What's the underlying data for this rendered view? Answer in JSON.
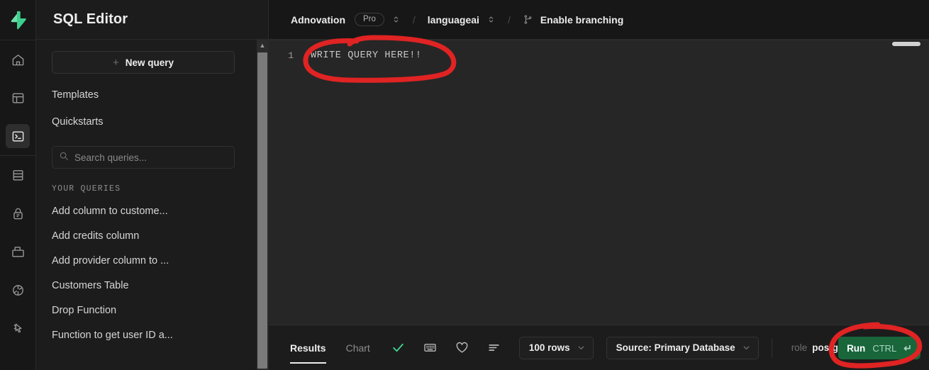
{
  "app": {
    "logo_icon": "supabase-lightning-logo",
    "sidebar_title": "SQL Editor"
  },
  "rail": {
    "items": [
      {
        "icon": "home-icon",
        "name": "home"
      },
      {
        "icon": "table-editor-icon",
        "name": "table-editor"
      },
      {
        "icon": "sql-editor-icon",
        "name": "sql-editor",
        "active": true
      },
      {
        "icon": "database-icon",
        "name": "database"
      },
      {
        "icon": "auth-lock-icon",
        "name": "authentication"
      },
      {
        "icon": "storage-folder-icon",
        "name": "storage"
      },
      {
        "icon": "edge-functions-icon",
        "name": "edge-functions"
      },
      {
        "icon": "advisors-cursor-icon",
        "name": "advisors"
      }
    ]
  },
  "sidebar": {
    "new_query_label": "New query",
    "new_query_icon": "plus-icon",
    "nav_links": [
      {
        "label": "Templates"
      },
      {
        "label": "Quickstarts"
      }
    ],
    "search": {
      "icon": "search-icon",
      "placeholder": "Search queries...",
      "value": ""
    },
    "section_label": "YOUR QUERIES",
    "queries": [
      {
        "label": "Add column to custome..."
      },
      {
        "label": "Add credits column"
      },
      {
        "label": "Add provider column to ..."
      },
      {
        "label": "Customers Table"
      },
      {
        "label": "Drop Function"
      },
      {
        "label": "Function to get user ID a..."
      }
    ],
    "scrollbar": {
      "up_arrow_icon": "chevron-up-icon"
    }
  },
  "topbar": {
    "organization": "Adnovation",
    "plan_badge": "Pro",
    "org_switcher_icon": "chevron-up-down-icon",
    "separator": "/",
    "project": "languageai",
    "project_switcher_icon": "chevron-up-down-icon",
    "branch_icon": "git-branch-icon",
    "branch_label": "Enable branching"
  },
  "editor": {
    "line_number": "1",
    "code": "WRITE QUERY HERE!!"
  },
  "bottombar": {
    "tabs": [
      {
        "label": "Results",
        "active": true
      },
      {
        "label": "Chart",
        "active": false
      }
    ],
    "status_icon": "check-icon",
    "tools": [
      {
        "icon": "keyboard-icon",
        "name": "keyboard-shortcuts"
      },
      {
        "icon": "heart-icon",
        "name": "favorite"
      },
      {
        "icon": "list-icon",
        "name": "sort-list"
      }
    ],
    "rows_selector": {
      "label": "100 rows",
      "caret_icon": "chevron-down-icon"
    },
    "source_selector": {
      "label": "Source: Primary Database",
      "caret_icon": "chevron-down-icon"
    },
    "role_selector": {
      "prefix": "role",
      "label": "postgres",
      "caret_icon": "chevron-down-icon"
    },
    "run_button": {
      "label": "Run",
      "shortcut": "CTRL",
      "enter_icon": "enter-return-icon"
    }
  },
  "annotations": {
    "color": "#e02323",
    "marks": [
      {
        "name": "write-query-here-highlight",
        "shape": "ellipse"
      },
      {
        "name": "run-button-highlight",
        "shape": "ellipse"
      }
    ]
  }
}
